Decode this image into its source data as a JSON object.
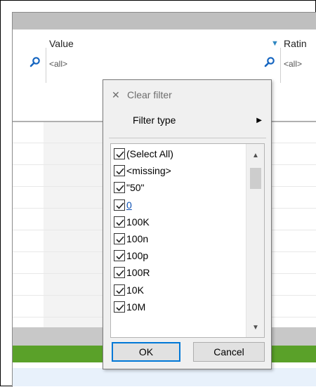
{
  "grid": {
    "columns": [
      {
        "header": "Value",
        "filter": "<all>"
      },
      {
        "header": "Ratin",
        "filter": "<all>"
      }
    ]
  },
  "filter_popup": {
    "clear_filter_label": "Clear filter",
    "filter_type_label": "Filter type",
    "items": [
      {
        "label": "(Select All)",
        "checked": true
      },
      {
        "label": "<missing>",
        "checked": true
      },
      {
        "label": "\"50\"",
        "checked": true
      },
      {
        "label": "0",
        "checked": true,
        "link": true
      },
      {
        "label": "100K",
        "checked": true
      },
      {
        "label": "100n",
        "checked": true
      },
      {
        "label": "100p",
        "checked": true
      },
      {
        "label": "100R",
        "checked": true
      },
      {
        "label": "10K",
        "checked": true
      },
      {
        "label": "10M",
        "checked": true
      }
    ],
    "ok_label": "OK",
    "cancel_label": "Cancel"
  },
  "colors": {
    "accent_blue": "#0078d7",
    "status_green": "#5aa129",
    "header_gray": "#bfbfbf"
  }
}
